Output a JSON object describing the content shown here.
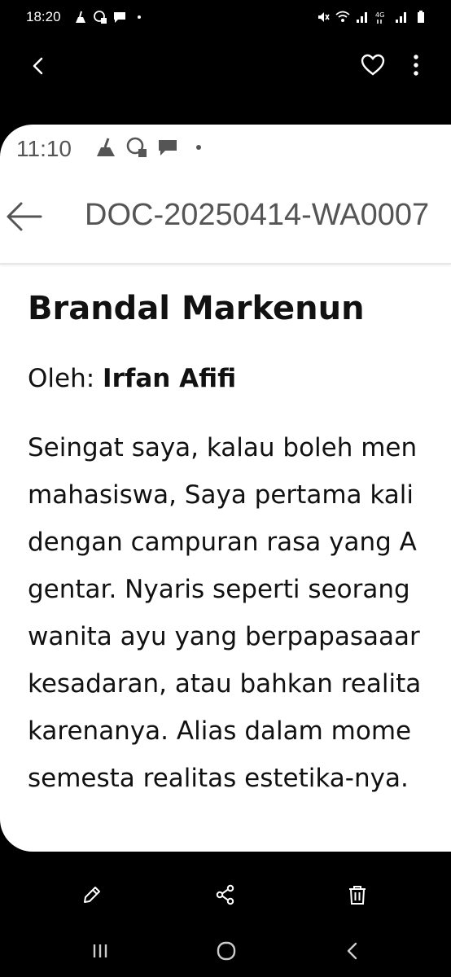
{
  "status_bar": {
    "time": "18:20",
    "left_icons": [
      "cleaning-icon",
      "whatsapp-icon",
      "message-icon",
      "dot-icon"
    ],
    "right_icons": [
      "mute-icon",
      "wifi-icon",
      "signal-icon",
      "4g-icon",
      "signal-icon",
      "battery-icon"
    ]
  },
  "viewer": {
    "back_icon": "chevron-left-icon",
    "favorite_icon": "heart-icon",
    "more_icon": "more-vertical-icon"
  },
  "screenshot": {
    "status_time": "11:10",
    "status_icons": [
      "cleaning-icon",
      "whatsapp-icon",
      "message-icon",
      "dot-icon"
    ],
    "doc_title": "DOC-20250414-WA0007",
    "heading": "Brandal Markenun",
    "author_prefix": "Oleh: ",
    "author_name": "Irfan Afifi",
    "paragraph_lines": [
      "Seingat saya, kalau boleh men",
      "mahasiswa, Saya pertama kali",
      "dengan campuran rasa yang A",
      "gentar. Nyaris seperti seorang",
      "wanita ayu yang berpapasaaar",
      "kesadaran, atau bahkan realita",
      "karenanya. Alias dalam mome",
      "semesta realitas estetika-nya."
    ]
  },
  "actions": {
    "edit_icon": "pencil-icon",
    "share_icon": "share-icon",
    "delete_icon": "trash-icon"
  },
  "navigation": {
    "recents_icon": "recent-apps-icon",
    "home_icon": "home-icon",
    "back_icon": "back-icon"
  }
}
